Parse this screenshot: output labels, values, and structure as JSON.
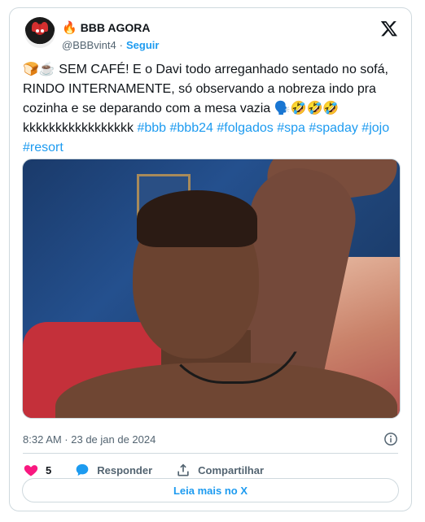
{
  "author": {
    "display_name": "BBB AGORA",
    "badge_emoji": "🔥",
    "handle": "@BBBvint4",
    "separator": "·",
    "follow_label": "Seguir"
  },
  "tweet": {
    "text": "🍞☕ SEM CAFÉ! E o Davi todo arreganhado sentado no sofá, RINDO INTERNAMENTE, só observando a nobreza indo pra cozinha e se deparando com a mesa vazia 🗣️🤣🤣🤣 kkkkkkkkkkkkkkkkk",
    "hashtags": [
      "#bbb",
      "#bbb24",
      "#folgados",
      "#spa",
      "#spaday",
      "#jojo",
      "#resort"
    ],
    "timestamp": "8:32 AM · 23 de jan de 2024"
  },
  "actions": {
    "like_count": "5",
    "reply_label": "Responder",
    "share_label": "Compartilhar"
  },
  "read_more_label": "Leia mais no X",
  "colors": {
    "accent": "#1d9bf0",
    "like": "#f91880",
    "muted": "#536471"
  },
  "icons": [
    "x-logo-icon",
    "info-icon",
    "heart-icon",
    "reply-bubble-icon",
    "share-icon"
  ]
}
